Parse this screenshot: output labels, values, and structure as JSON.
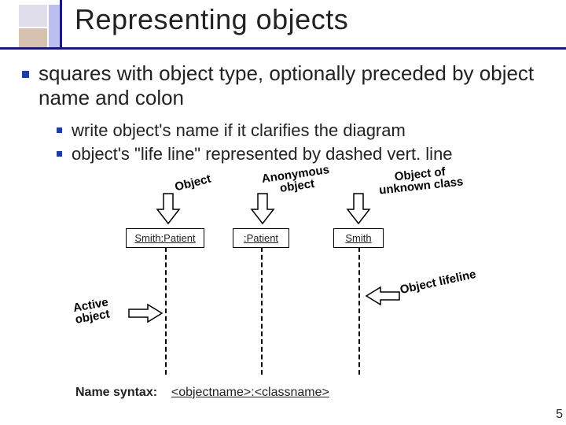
{
  "title": "Representing objects",
  "bullets": {
    "level1": "squares with object type, optionally preceded by object name and colon",
    "sub1": "write object's name if it clarifies the diagram",
    "sub2": "object's \"life line\" represented by dashed vert. line"
  },
  "diagram": {
    "box1": "Smith:Patient",
    "box2": ":Patient",
    "box3": "Smith",
    "cue_object": "Object",
    "cue_anon": "Anonymous object",
    "cue_unknown": "Object of unknown class",
    "cue_active": "Active object",
    "cue_lifeline": "Object lifeline"
  },
  "syntax": {
    "label": "Name syntax:",
    "value": "<objectname>:<classname>"
  },
  "page": "5"
}
